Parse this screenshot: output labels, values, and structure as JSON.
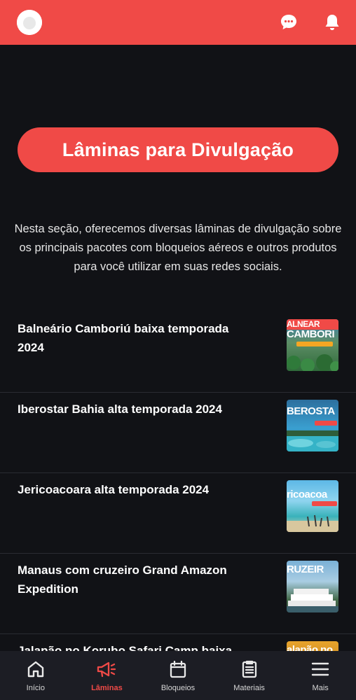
{
  "header": {
    "avatar_icon": "user-avatar-icon",
    "chat_icon": "chat-bubble-icon",
    "notifications_icon": "bell-icon",
    "accent_color": "#f04a47"
  },
  "main": {
    "title": "Lâminas para Divulgação",
    "intro": "Nesta seção, oferecemos diversas lâminas de divulgação sobre os principais pacotes com bloqueios aéreos e outros produtos para você utilizar em suas redes sociais.",
    "items": [
      {
        "title": "Balneário Camboriú baixa temporada 2024",
        "thumb_text": "CAMBORI"
      },
      {
        "title": "Iberostar Bahia alta temporada 2024",
        "thumb_text": "BEROSTA"
      },
      {
        "title": "Jericoacoara alta temporada 2024",
        "thumb_text": "ricoacoa"
      },
      {
        "title": "Manaus com cruzeiro Grand Amazon Expedition",
        "thumb_text": "RUZEIR"
      },
      {
        "title": "Jalapão no Korubo Safari Camp baixa",
        "thumb_text": "alapão no"
      }
    ]
  },
  "bottom_nav": {
    "items": [
      {
        "label": "Início",
        "icon": "home-icon",
        "active": false
      },
      {
        "label": "Lâminas",
        "icon": "megaphone-icon",
        "active": true
      },
      {
        "label": "Bloqueios",
        "icon": "calendar-icon",
        "active": false
      },
      {
        "label": "Materiais",
        "icon": "clipboard-icon",
        "active": false
      },
      {
        "label": "Mais",
        "icon": "menu-icon",
        "active": false
      }
    ]
  }
}
